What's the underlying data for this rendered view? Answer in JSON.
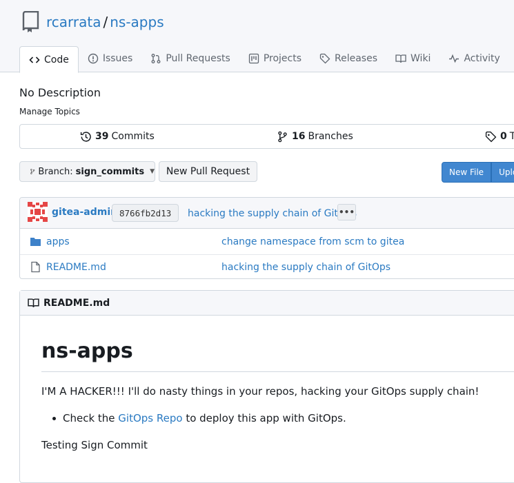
{
  "repo": {
    "owner": "rcarrata",
    "separator": "/",
    "name": "ns-apps"
  },
  "tabs": [
    {
      "label": "Code",
      "icon": "code-icon"
    },
    {
      "label": "Issues",
      "icon": "issue-icon"
    },
    {
      "label": "Pull Requests",
      "icon": "pull-request-icon"
    },
    {
      "label": "Projects",
      "icon": "project-icon"
    },
    {
      "label": "Releases",
      "icon": "tag-icon"
    },
    {
      "label": "Wiki",
      "icon": "book-icon"
    },
    {
      "label": "Activity",
      "icon": "pulse-icon"
    }
  ],
  "description": "No Description",
  "manage_topics": "Manage Topics",
  "stats": {
    "commits_count": "39",
    "commits_label": "Commits",
    "branches_count": "16",
    "branches_label": "Branches",
    "tags_count": "0",
    "tags_label": "Ta"
  },
  "branch": {
    "prefix": "Branch:",
    "name": "sign_commits"
  },
  "buttons": {
    "new_pull_request": "New Pull Request",
    "new_file": "New File",
    "upload": "Uplo"
  },
  "latest_commit": {
    "author": "gitea-admin",
    "sha": "8766fb2d13",
    "message": "hacking the supply chain of GitOps",
    "more": "•••"
  },
  "files": [
    {
      "name": "apps",
      "type": "folder",
      "commit": "change namespace from scm to gitea"
    },
    {
      "name": "README.md",
      "type": "file",
      "commit": "hacking the supply chain of GitOps"
    }
  ],
  "readme": {
    "filename": "README.md",
    "heading": "ns-apps",
    "paragraph1": "I'M A HACKER!!! I'll do nasty things in your repos, hacking your GitOps supply chain!",
    "list_item_before": "Check the ",
    "list_item_link": "GitOps Repo",
    "list_item_after": " to deploy this app with GitOps.",
    "paragraph2": "Testing Sign Commit"
  },
  "colors": {
    "link": "#2a7ac2",
    "primary": "#4187d0",
    "header_bg": "#f6f7fa",
    "border": "#d0d7de"
  }
}
